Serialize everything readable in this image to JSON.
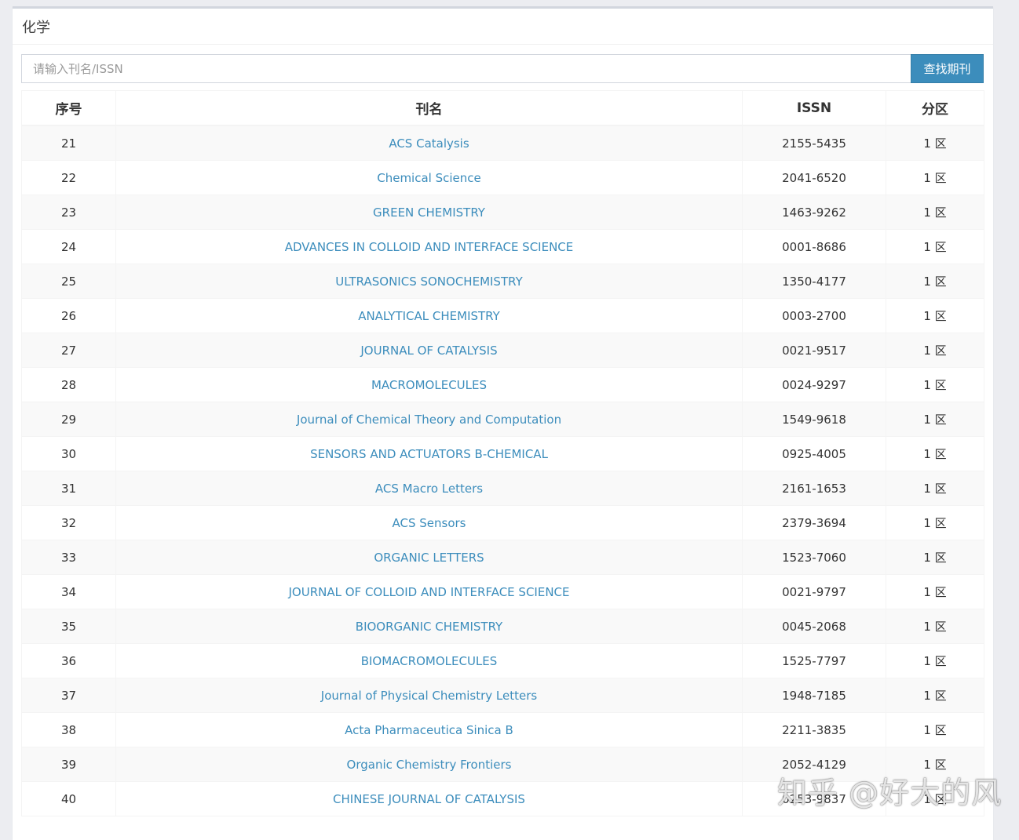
{
  "panel": {
    "title": "化学"
  },
  "search": {
    "placeholder": "请输入刊名/ISSN",
    "value": "",
    "button_label": "查找期刊"
  },
  "table": {
    "headers": {
      "no": "序号",
      "name": "刊名",
      "issn": "ISSN",
      "zone": "分区"
    },
    "rows": [
      {
        "no": "21",
        "name": "ACS Catalysis",
        "issn": "2155-5435",
        "zone": "1 区"
      },
      {
        "no": "22",
        "name": "Chemical Science",
        "issn": "2041-6520",
        "zone": "1 区"
      },
      {
        "no": "23",
        "name": "GREEN CHEMISTRY",
        "issn": "1463-9262",
        "zone": "1 区"
      },
      {
        "no": "24",
        "name": "ADVANCES IN COLLOID AND INTERFACE SCIENCE",
        "issn": "0001-8686",
        "zone": "1 区"
      },
      {
        "no": "25",
        "name": "ULTRASONICS SONOCHEMISTRY",
        "issn": "1350-4177",
        "zone": "1 区"
      },
      {
        "no": "26",
        "name": "ANALYTICAL CHEMISTRY",
        "issn": "0003-2700",
        "zone": "1 区"
      },
      {
        "no": "27",
        "name": "JOURNAL OF CATALYSIS",
        "issn": "0021-9517",
        "zone": "1 区"
      },
      {
        "no": "28",
        "name": "MACROMOLECULES",
        "issn": "0024-9297",
        "zone": "1 区"
      },
      {
        "no": "29",
        "name": "Journal of Chemical Theory and Computation",
        "issn": "1549-9618",
        "zone": "1 区"
      },
      {
        "no": "30",
        "name": "SENSORS AND ACTUATORS B-CHEMICAL",
        "issn": "0925-4005",
        "zone": "1 区"
      },
      {
        "no": "31",
        "name": "ACS Macro Letters",
        "issn": "2161-1653",
        "zone": "1 区"
      },
      {
        "no": "32",
        "name": "ACS Sensors",
        "issn": "2379-3694",
        "zone": "1 区"
      },
      {
        "no": "33",
        "name": "ORGANIC LETTERS",
        "issn": "1523-7060",
        "zone": "1 区"
      },
      {
        "no": "34",
        "name": "JOURNAL OF COLLOID AND INTERFACE SCIENCE",
        "issn": "0021-9797",
        "zone": "1 区"
      },
      {
        "no": "35",
        "name": "BIOORGANIC CHEMISTRY",
        "issn": "0045-2068",
        "zone": "1 区"
      },
      {
        "no": "36",
        "name": "BIOMACROMOLECULES",
        "issn": "1525-7797",
        "zone": "1 区"
      },
      {
        "no": "37",
        "name": "Journal of Physical Chemistry Letters",
        "issn": "1948-7185",
        "zone": "1 区"
      },
      {
        "no": "38",
        "name": "Acta Pharmaceutica Sinica B",
        "issn": "2211-3835",
        "zone": "1 区"
      },
      {
        "no": "39",
        "name": "Organic Chemistry Frontiers",
        "issn": "2052-4129",
        "zone": "1 区"
      },
      {
        "no": "40",
        "name": "CHINESE JOURNAL OF CATALYSIS",
        "issn": "0253-9837",
        "zone": "1 区"
      }
    ]
  },
  "watermark": {
    "text": "知乎 @好大的风"
  },
  "colors": {
    "link": "#3c8dbc",
    "button": "#3c8dbc",
    "background": "#ecedf1",
    "row_stripe": "#f9f9f9"
  }
}
